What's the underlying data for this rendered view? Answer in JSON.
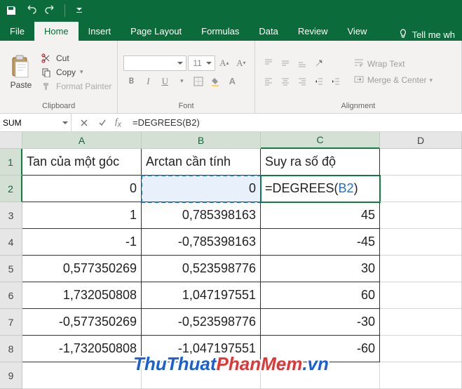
{
  "qat": {
    "save": "Save",
    "undo": "Undo",
    "redo": "Redo"
  },
  "tabs": {
    "file": "File",
    "home": "Home",
    "insert": "Insert",
    "pageLayout": "Page Layout",
    "formulas": "Formulas",
    "data": "Data",
    "review": "Review",
    "view": "View",
    "tellMe": "Tell me wh"
  },
  "ribbon": {
    "clipboard": {
      "paste": "Paste",
      "cut": "Cut",
      "copy": "Copy",
      "formatPainter": "Format Painter",
      "label": "Clipboard"
    },
    "font": {
      "face": "",
      "size": "11",
      "bold": "B",
      "italic": "I",
      "underline": "U",
      "label": "Font"
    },
    "alignment": {
      "wrap": "Wrap Text",
      "merge": "Merge & Center",
      "label": "Alignment"
    }
  },
  "namebox": "SUM",
  "formula": "=DEGREES(B2)",
  "columns": [
    "A",
    "B",
    "C",
    "D"
  ],
  "rows": [
    "1",
    "2",
    "3",
    "4",
    "5",
    "6",
    "7",
    "8",
    "9"
  ],
  "editing": {
    "prefix": "=DEGREES(",
    "ref": "B2",
    "suffix": ")"
  },
  "chart_data": {
    "type": "table",
    "headers": [
      "Tan của một góc",
      "Arctan cần tính",
      "Suy ra số độ"
    ],
    "rows": [
      [
        "0",
        "0",
        "=DEGREES(B2)"
      ],
      [
        "1",
        "0,785398163",
        "45"
      ],
      [
        "-1",
        "-0,785398163",
        "-45"
      ],
      [
        "0,577350269",
        "0,523598776",
        "30"
      ],
      [
        "1,732050808",
        "1,047197551",
        "60"
      ],
      [
        "-0,577350269",
        "-0,523598776",
        "-30"
      ],
      [
        "-1,732050808",
        "-1,047197551",
        "-60"
      ]
    ]
  },
  "watermark": {
    "a": "ThuThuat",
    "b": "PhanMem",
    "c": ".vn"
  }
}
